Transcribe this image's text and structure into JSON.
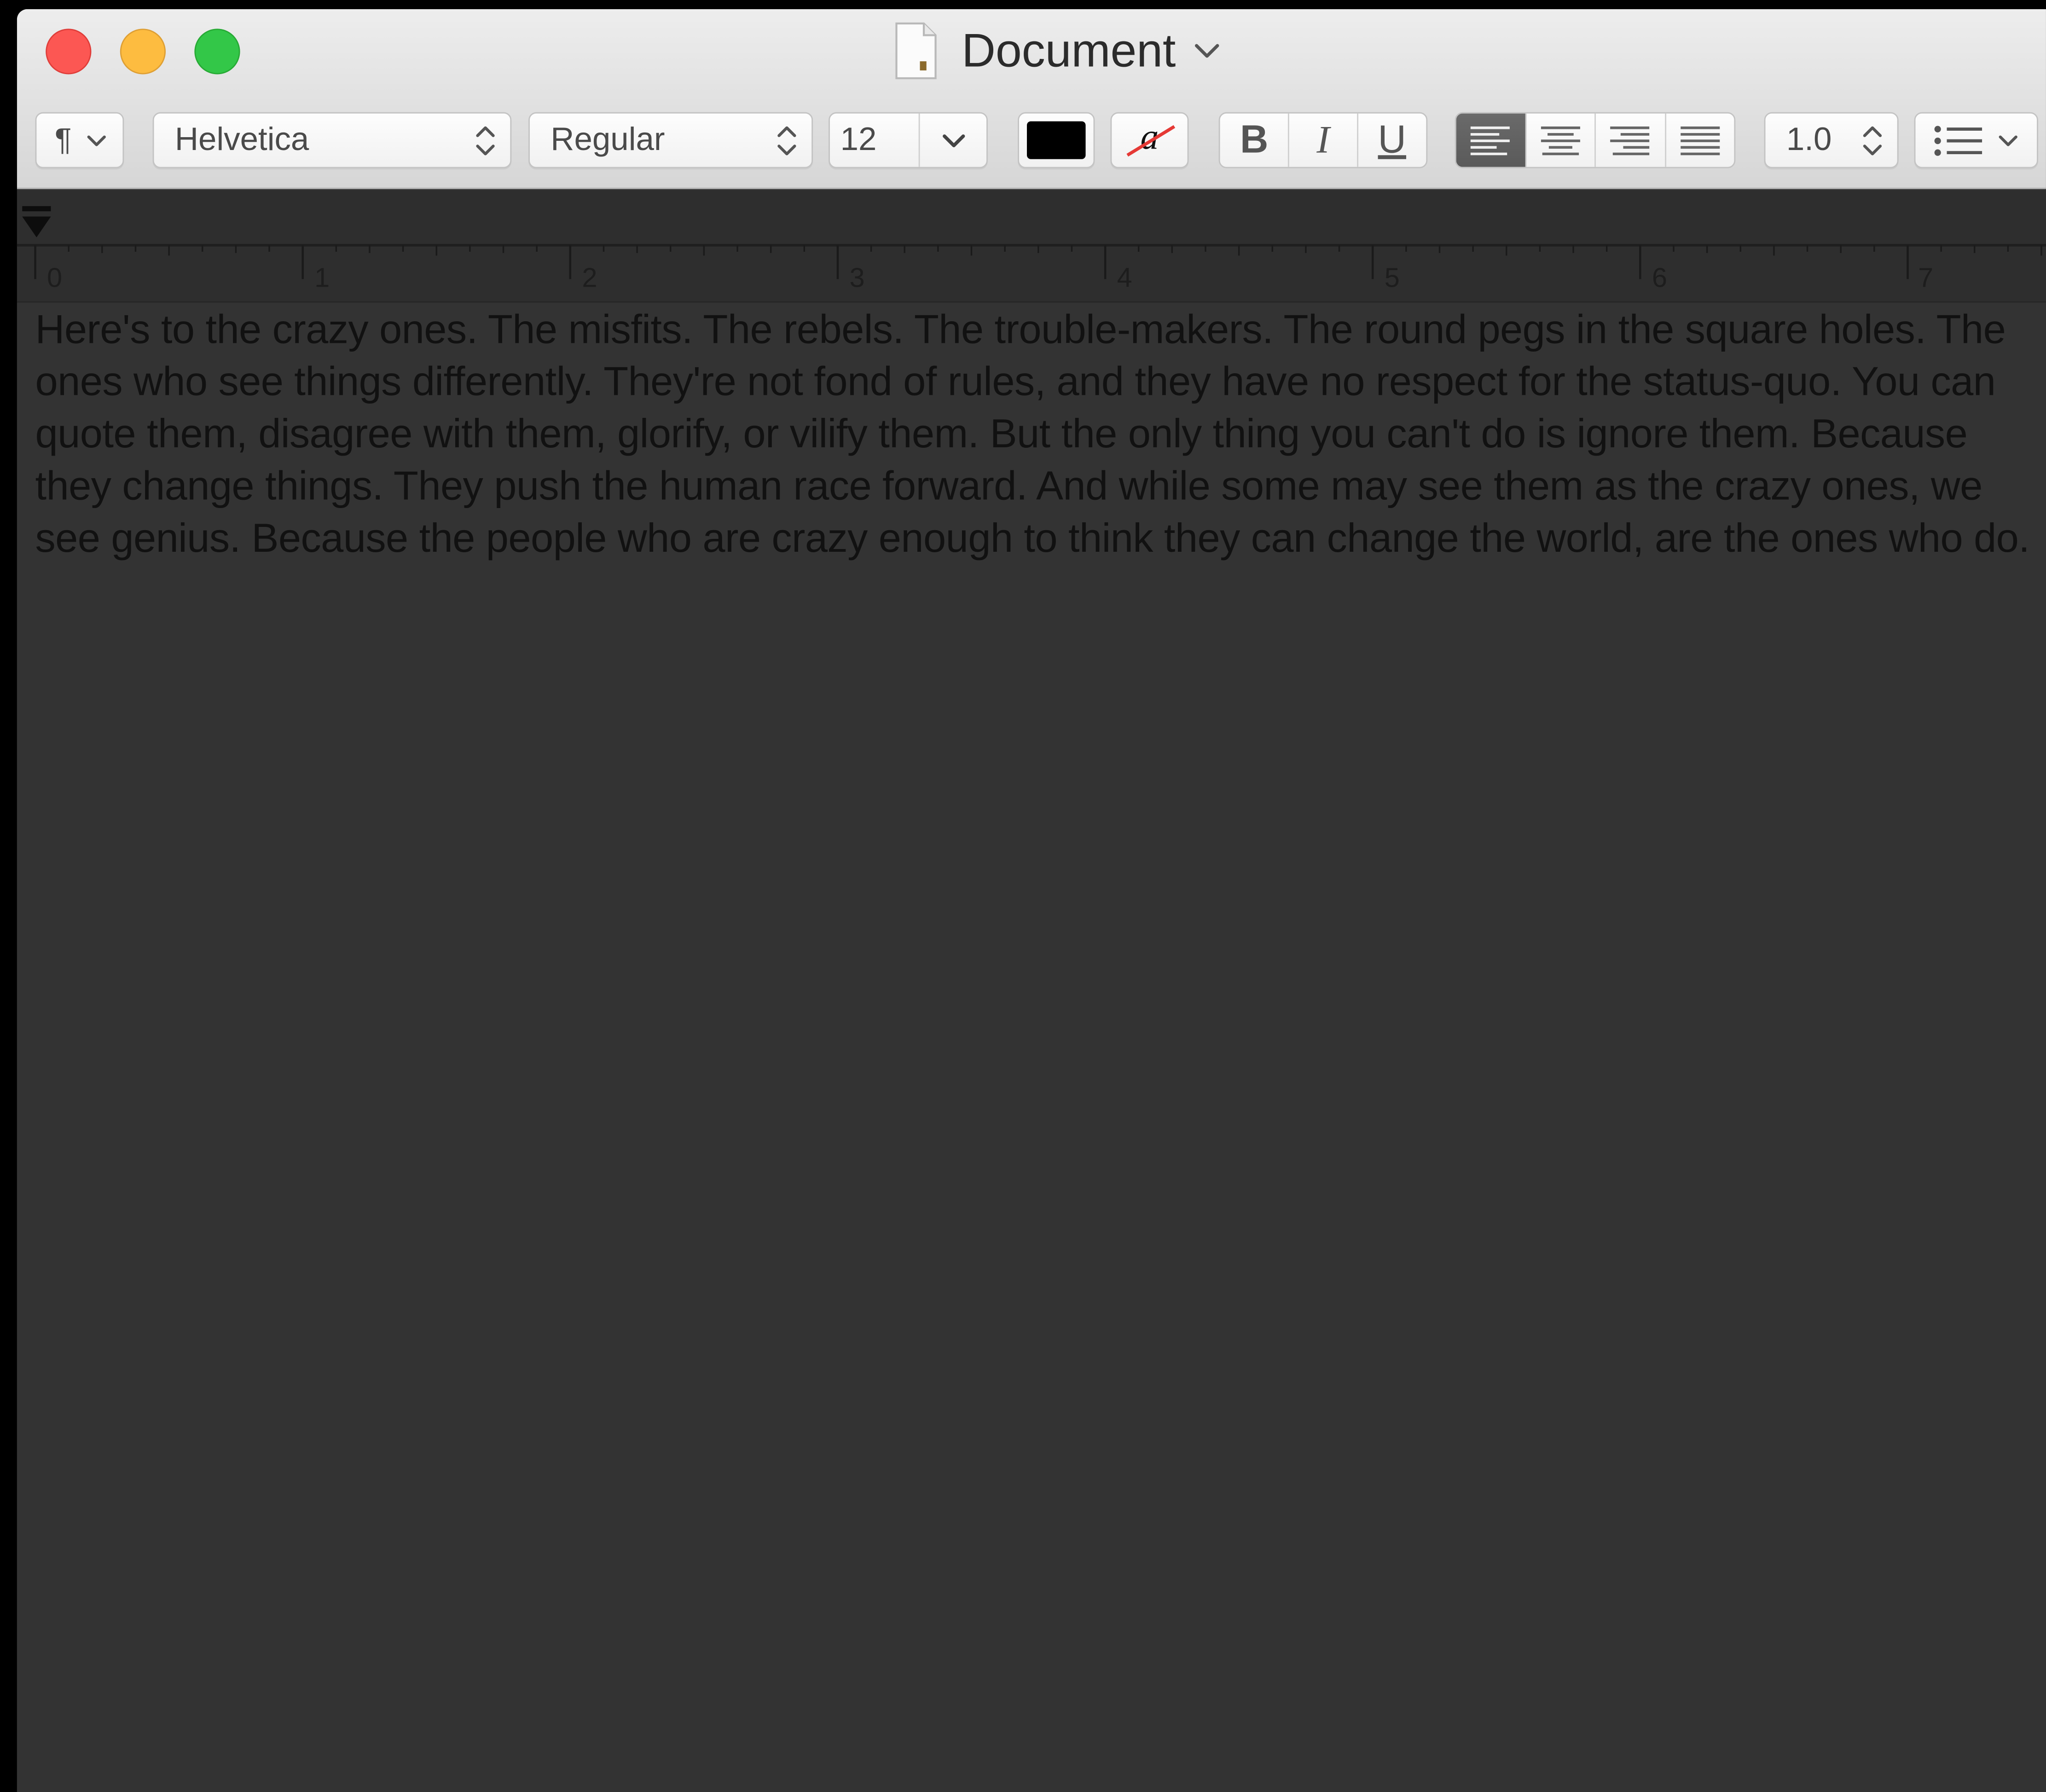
{
  "window": {
    "title": "Document"
  },
  "toolbar": {
    "paragraph_style": "¶",
    "font_family": "Helvetica",
    "font_typeface": "Regular",
    "font_size": "12",
    "text_color": "#000000",
    "highlight_glyph": "a",
    "bold_label": "B",
    "italic_label": "I",
    "underline_label": "U",
    "alignment_selected": "left",
    "line_spacing": "1.0"
  },
  "ruler": {
    "marks": [
      "0",
      "1",
      "2",
      "3",
      "4",
      "5",
      "6",
      "7"
    ]
  },
  "document": {
    "text": "Here's to the crazy ones. The misfits. The rebels. The trouble-makers. The round pegs in the square holes. The ones who see things differently. They're not fond of rules, and they have no respect for the status-quo. You can quote them, disagree with them, glorify, or vilify them. But the only thing you can't do is ignore them. Because they change things. They push the human race forward. And while some may see them as the crazy ones, we see genius. Because the people who are crazy enough to think they can change the world, are the ones who do."
  },
  "colors": {
    "close": "#fc5753",
    "minimize": "#fdbc40",
    "zoom": "#33c748",
    "canvas": "#333333"
  },
  "icons": {
    "document": "document-icon",
    "list": "list-bullets-icon"
  }
}
